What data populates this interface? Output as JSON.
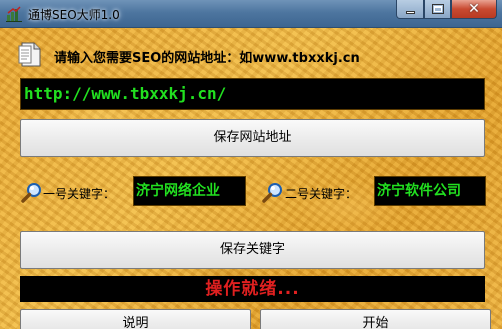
{
  "window": {
    "title": "通博SEO大师1.0",
    "close_glyph": "✕"
  },
  "prompt": {
    "icon": "document-icon",
    "text": "请输入您需要SEO的网站地址：如www.tbxxkj.cn"
  },
  "url_field": {
    "value": "http://www.tbxxkj.cn/"
  },
  "buttons": {
    "save_url": "保存网站地址",
    "save_keywords": "保存关键字",
    "help": "说明",
    "start": "开始"
  },
  "keywords": {
    "kw1": {
      "icon": "search-icon",
      "label": "一号关键字：",
      "value": "济宁网络企业"
    },
    "kw2": {
      "icon": "search-icon",
      "label": "二号关键字：",
      "value": "济宁软件公司"
    }
  },
  "status": {
    "text": "操作就绪..."
  },
  "colors": {
    "field_text": "#22e020",
    "status_text": "#e02020",
    "field_background": "#000000",
    "window_background": "#eeb444"
  }
}
